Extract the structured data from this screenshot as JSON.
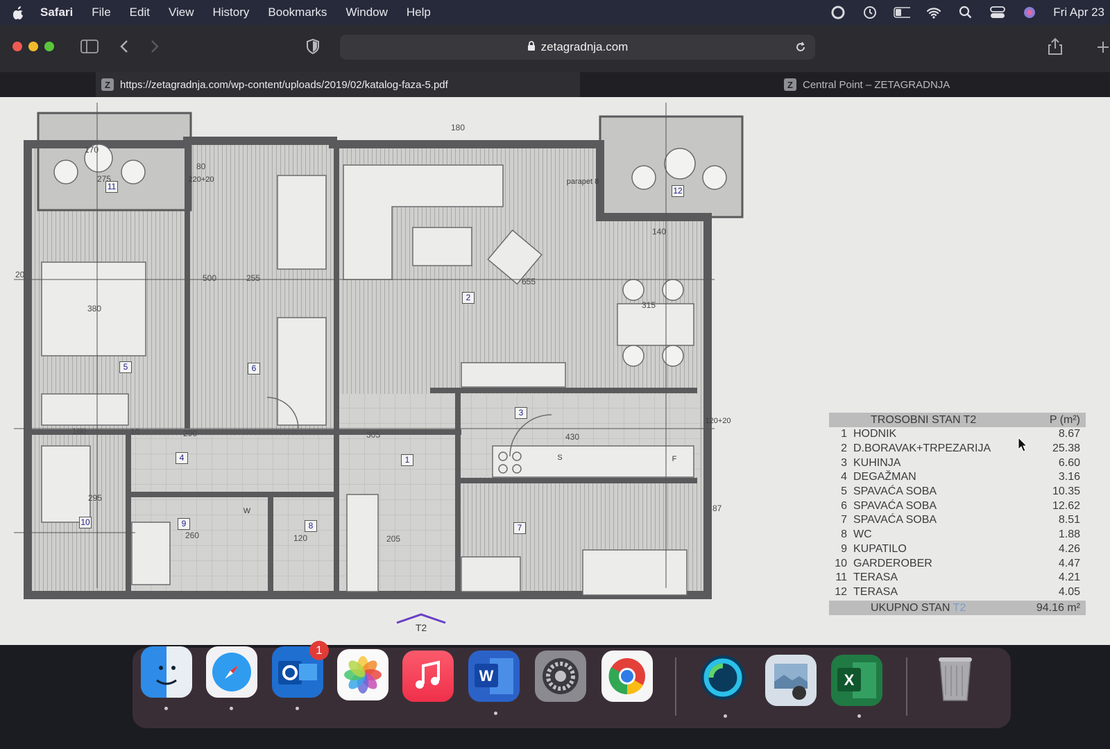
{
  "menubar": {
    "app": "Safari",
    "items": [
      "File",
      "Edit",
      "View",
      "History",
      "Bookmarks",
      "Window",
      "Help"
    ],
    "clock": "Fri Apr 23"
  },
  "toolbar": {
    "address": "zetagradnja.com"
  },
  "tabs": [
    {
      "favicon": "Z",
      "title": "https://zetagradnja.com/wp-content/uploads/2019/02/katalog-faza-5.pdf"
    },
    {
      "favicon": "Z",
      "title": "Central Point – ZETAGRADNJA"
    }
  ],
  "plan": {
    "rooms": [
      "1",
      "2",
      "3",
      "4",
      "5",
      "6",
      "7",
      "8",
      "9",
      "10",
      "11",
      "12"
    ],
    "dimensions": [
      "275",
      "380",
      "500",
      "255",
      "655",
      "315",
      "290",
      "305",
      "430",
      "295",
      "260",
      "120",
      "205",
      "160",
      "10",
      "20",
      "80",
      "170",
      "180",
      "140",
      "87"
    ],
    "labels": [
      "220+20",
      "120+20",
      "parapet 8",
      "S",
      "F",
      "W",
      "T2"
    ]
  },
  "area_table": {
    "title": "TROSOBNI STAN T2",
    "unit_header": "P (m²)",
    "rows": [
      {
        "n": "1",
        "name": "HODNIK",
        "value": "8.67"
      },
      {
        "n": "2",
        "name": "D.BORAVAK+TRPEZARIJA",
        "value": "25.38"
      },
      {
        "n": "3",
        "name": "KUHINJA",
        "value": "6.60"
      },
      {
        "n": "4",
        "name": "DEGAŽMAN",
        "value": "3.16"
      },
      {
        "n": "5",
        "name": "SPAVAĆA SOBA",
        "value": "10.35"
      },
      {
        "n": "6",
        "name": "SPAVAĆA SOBA",
        "value": "12.62"
      },
      {
        "n": "7",
        "name": "SPAVAĆA SOBA",
        "value": "8.51"
      },
      {
        "n": "8",
        "name": "WC",
        "value": "1.88"
      },
      {
        "n": "9",
        "name": "KUPATILO",
        "value": "4.26"
      },
      {
        "n": "10",
        "name": "GARDEROBER",
        "value": "4.47"
      },
      {
        "n": "11",
        "name": "TERASA",
        "value": "4.21"
      },
      {
        "n": "12",
        "name": "TERASA",
        "value": "4.05"
      }
    ],
    "total_label": "UKUPNO STAN",
    "total_unit": "T2",
    "total_value": "94.16 m²"
  },
  "dock": {
    "apps": [
      "Finder",
      "Safari",
      "Outlook",
      "Photos",
      "Music",
      "Word",
      "System Preferences",
      "Chrome",
      "Webex",
      "Preview",
      "Excel",
      "Trash"
    ],
    "outlook_badge": "1"
  },
  "colors": {
    "menubar": "#262a3a",
    "page": "#e9eae8",
    "wall": "#5a5a5c"
  }
}
